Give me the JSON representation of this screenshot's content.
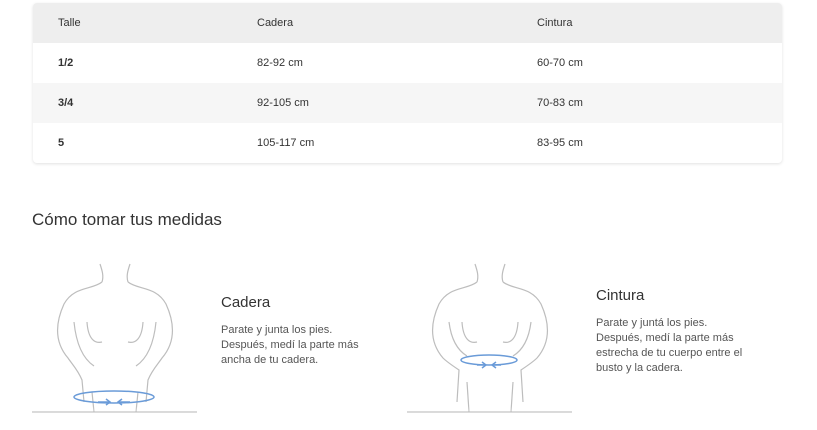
{
  "table": {
    "headers": [
      "Talle",
      "Cadera",
      "Cintura"
    ],
    "rows": [
      [
        "1/2",
        "82-92 cm",
        "60-70 cm"
      ],
      [
        "3/4",
        "92-105 cm",
        "70-83 cm"
      ],
      [
        "5",
        "105-117 cm",
        "83-95 cm"
      ]
    ]
  },
  "section_title": "Cómo tomar tus medidas",
  "guides": [
    {
      "title": "Cadera",
      "lines": [
        "Parate y junta los pies.",
        "Después, medí la parte más",
        "ancha de tu cadera."
      ],
      "icon": "hip-measure-figure-icon"
    },
    {
      "title": "Cintura",
      "lines": [
        "Parate y juntá los pies.",
        "Después, medí la parte más",
        "estrecha de tu cuerpo entre el",
        "busto y la cadera."
      ],
      "icon": "waist-measure-figure-icon"
    }
  ],
  "colors": {
    "header_bg": "#eeeeee",
    "alt_row_bg": "#f6f6f6",
    "tape": "#6a9bd8"
  }
}
